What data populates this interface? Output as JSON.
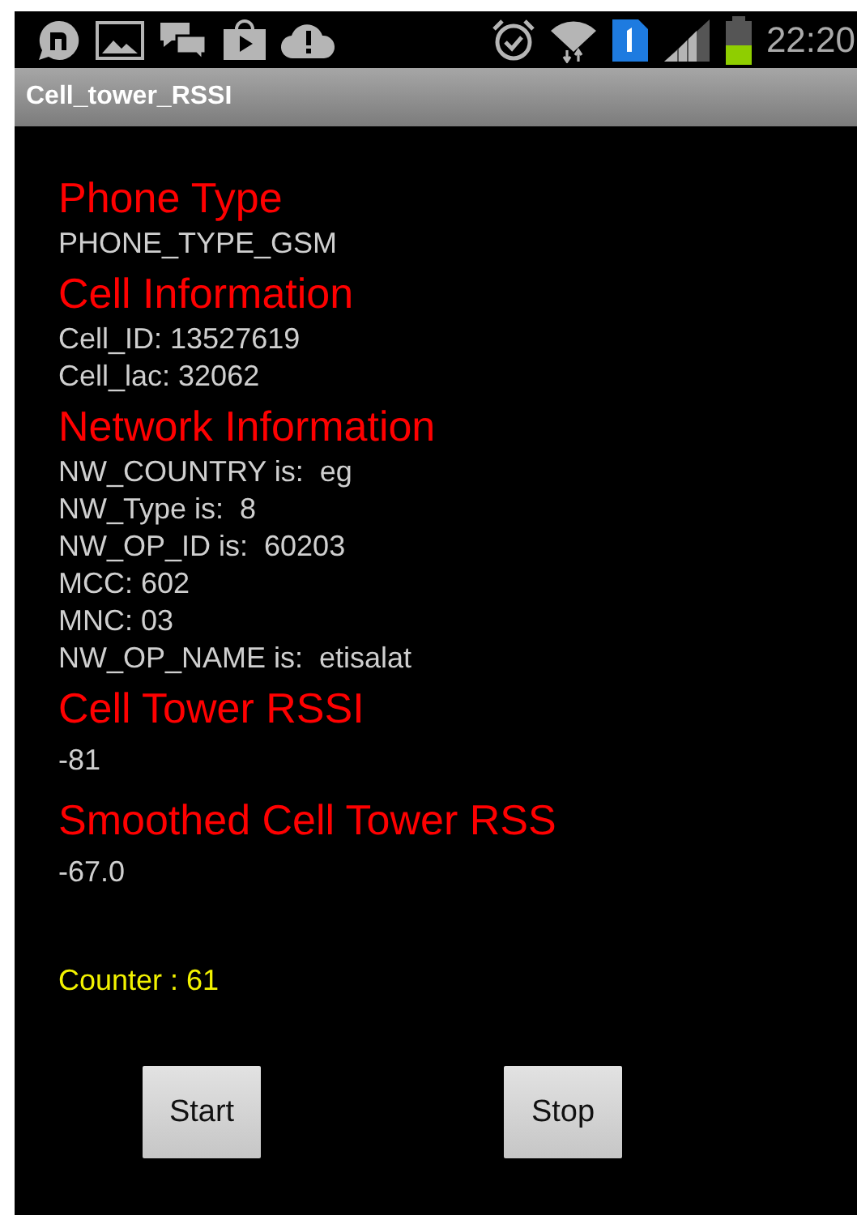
{
  "status_bar": {
    "time": "22:20"
  },
  "window": {
    "title": "Cell_tower_RSSI"
  },
  "sections": [
    {
      "heading": "Phone Type",
      "lines": [
        "PHONE_TYPE_GSM"
      ]
    },
    {
      "heading": "Cell Information",
      "lines": [
        "Cell_ID: 13527619",
        "Cell_lac: 32062"
      ]
    },
    {
      "heading": "Network Information",
      "lines": [
        "NW_COUNTRY is:  eg",
        "NW_Type is:  8",
        "NW_OP_ID is:  60203",
        "MCC: 602",
        "MNC: 03",
        "NW_OP_NAME is:  etisalat"
      ]
    },
    {
      "heading": "Cell Tower RSSI",
      "lines": [
        "-81"
      ]
    },
    {
      "heading": "Smoothed Cell Tower RSS",
      "lines": [
        "-67.0"
      ]
    }
  ],
  "counter": "Counter : 61",
  "buttons": [
    "Start",
    "Stop"
  ]
}
